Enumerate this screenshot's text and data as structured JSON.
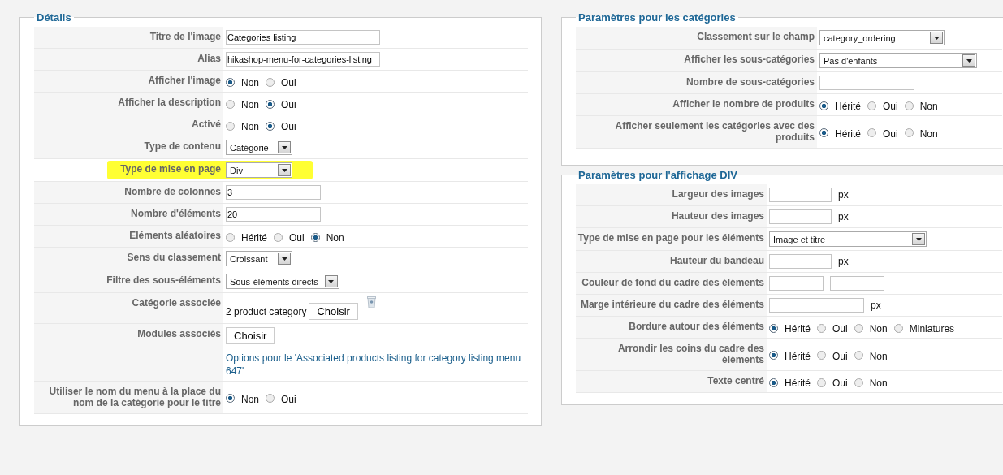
{
  "fieldsets": [
    {
      "legend": "Détails",
      "rows": [
        {
          "label": "Titre de l'image",
          "kind": "text-wide",
          "value": "Categories listing"
        },
        {
          "label": "Alias",
          "kind": "text-wide",
          "value": "hikashop-menu-for-categories-listing"
        },
        {
          "label": "Afficher l'image",
          "kind": "radio",
          "options": [
            {
              "label": "Non",
              "selected": true
            },
            {
              "label": "Oui",
              "selected": false
            }
          ]
        },
        {
          "label": "Afficher la description",
          "kind": "radio",
          "options": [
            {
              "label": "Non",
              "selected": false
            },
            {
              "label": "Oui",
              "selected": true
            }
          ]
        },
        {
          "label": "Activé",
          "kind": "radio",
          "options": [
            {
              "label": "Non",
              "selected": false
            },
            {
              "label": "Oui",
              "selected": true
            }
          ]
        },
        {
          "label": "Type de contenu",
          "kind": "select",
          "value": "Catégorie"
        },
        {
          "label": "Type de mise en page",
          "kind": "select",
          "value": "Div",
          "highlighted": true
        },
        {
          "label": "Nombre de colonnes",
          "kind": "text",
          "value": "3"
        },
        {
          "label": "Nombre d'éléments",
          "kind": "text",
          "value": "20"
        },
        {
          "label": "Eléments aléatoires",
          "kind": "radio",
          "options": [
            {
              "label": "Hérité",
              "selected": false
            },
            {
              "label": "Oui",
              "selected": false
            },
            {
              "label": "Non",
              "selected": true
            }
          ]
        },
        {
          "label": "Sens du classement",
          "kind": "select",
          "value": "Croissant"
        },
        {
          "label": "Filtre des sous-éléments",
          "kind": "select",
          "value": "Sous-éléments directs"
        },
        {
          "label": "Catégorie associée",
          "kind": "picker",
          "value": "2 product category",
          "button": "Choisir"
        },
        {
          "label": "Modules associés",
          "kind": "modules",
          "button": "Choisir",
          "link": "Options pour le 'Associated products listing for category listing menu 647'"
        },
        {
          "label": "Utiliser le nom du menu à la place du nom de la catégorie pour le titre",
          "kind": "radio",
          "options": [
            {
              "label": "Non",
              "selected": true
            },
            {
              "label": "Oui",
              "selected": false
            }
          ]
        }
      ]
    },
    {
      "legend": "Paramètres pour les catégories",
      "rows": [
        {
          "label": "Classement sur le champ",
          "kind": "select",
          "value": "category_ordering"
        },
        {
          "label": "Afficher les sous-catégories",
          "kind": "select-wide",
          "value": "Pas d'enfants"
        },
        {
          "label": "Nombre de sous-catégories",
          "kind": "text"
        },
        {
          "label": "Afficher le nombre de produits",
          "kind": "radio",
          "options": [
            {
              "label": "Hérité",
              "selected": true
            },
            {
              "label": "Oui",
              "selected": false
            },
            {
              "label": "Non",
              "selected": false
            }
          ]
        },
        {
          "label": "Afficher seulement les catégories avec des produits",
          "kind": "radio",
          "options": [
            {
              "label": "Hérité",
              "selected": true
            },
            {
              "label": "Oui",
              "selected": false
            },
            {
              "label": "Non",
              "selected": false
            }
          ]
        }
      ]
    },
    {
      "legend": "Paramètres pour l'affichage DIV",
      "rows": [
        {
          "label": "Largeur des images",
          "kind": "text",
          "unit": "px"
        },
        {
          "label": "Hauteur des images",
          "kind": "text",
          "unit": "px"
        },
        {
          "label": "Type de mise en page pour les éléments",
          "kind": "select-wide",
          "value": "Image et titre"
        },
        {
          "label": "Hauteur du bandeau",
          "kind": "text",
          "unit": "px"
        },
        {
          "label": "Couleur de fond du cadre des éléments",
          "kind": "double"
        },
        {
          "label": "Marge intérieure du cadre des éléments",
          "kind": "text-wide",
          "unit": "px"
        },
        {
          "label": "Bordure autour des éléments",
          "kind": "radio",
          "options": [
            {
              "label": "Hérité",
              "selected": true
            },
            {
              "label": "Oui",
              "selected": false
            },
            {
              "label": "Non",
              "selected": false
            },
            {
              "label": "Miniatures",
              "selected": false
            }
          ]
        },
        {
          "label": "Arrondir les coins du cadre des éléments",
          "kind": "radio",
          "options": [
            {
              "label": "Hérité",
              "selected": true
            },
            {
              "label": "Oui",
              "selected": false
            },
            {
              "label": "Non",
              "selected": false
            }
          ]
        },
        {
          "label": "Texte centré",
          "kind": "radio",
          "options": [
            {
              "label": "Hérité",
              "selected": true
            },
            {
              "label": "Oui",
              "selected": false
            },
            {
              "label": "Non",
              "selected": false
            }
          ]
        }
      ]
    }
  ]
}
